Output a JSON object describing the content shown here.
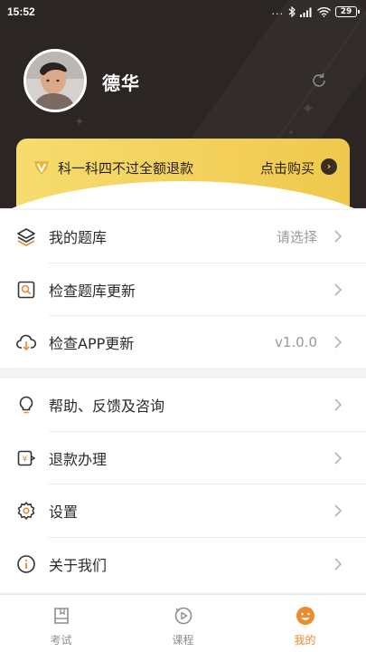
{
  "status_bar": {
    "time": "15:52",
    "dots": "...",
    "icons": [
      "bluetooth-icon",
      "signal-icon",
      "wifi-icon",
      "battery-icon"
    ],
    "battery": "29"
  },
  "profile": {
    "username": "德华",
    "refresh_icon": "refresh-icon"
  },
  "banner": {
    "promo_text": "科一科四不过全额退款",
    "buy_label": "点击购买",
    "accent": "#f3d061"
  },
  "menu_group_1": [
    {
      "icon": "layers-icon",
      "label": "我的题库",
      "value": "请选择"
    },
    {
      "icon": "search-doc-icon",
      "label": "检查题库更新",
      "value": ""
    },
    {
      "icon": "cloud-download-icon",
      "label": "检查APP更新",
      "value": "v1.0.0"
    }
  ],
  "menu_group_2": [
    {
      "icon": "lightbulb-icon",
      "label": "帮助、反馈及咨询",
      "value": ""
    },
    {
      "icon": "refund-icon",
      "label": "退款办理",
      "value": ""
    },
    {
      "icon": "settings-icon",
      "label": "设置",
      "value": ""
    },
    {
      "icon": "info-icon",
      "label": "关于我们",
      "value": ""
    }
  ],
  "tabs": [
    {
      "label": "考试",
      "icon": "exam-icon",
      "active": false
    },
    {
      "label": "课程",
      "icon": "course-icon",
      "active": false
    },
    {
      "label": "我的",
      "icon": "me-icon",
      "active": true
    }
  ],
  "colors": {
    "header_bg": "#2b2624",
    "banner_gold": "#f0c84c",
    "active_tab": "#f08a2e"
  }
}
